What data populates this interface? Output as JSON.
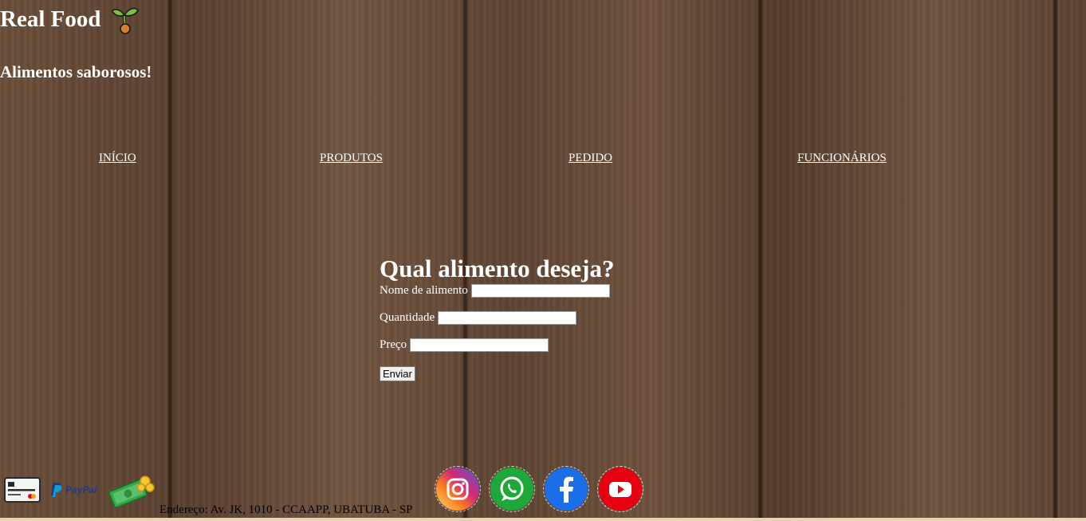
{
  "header": {
    "title": "Real Food",
    "title_icon": "sprout-icon",
    "tagline": "Alimentos saborosos!"
  },
  "nav": {
    "items": [
      {
        "label": "INÍCIO"
      },
      {
        "label": "PRODUTOS"
      },
      {
        "label": "PEDIDO"
      },
      {
        "label": "FUNCIONÁRIOS"
      }
    ]
  },
  "form": {
    "title": "Qual alimento deseja?",
    "fields": [
      {
        "label": "Nome de alimento",
        "value": ""
      },
      {
        "label": "Quantidade",
        "value": ""
      },
      {
        "label": "Preço",
        "value": ""
      }
    ],
    "submit_label": "Enviar"
  },
  "footer": {
    "payment_icons": [
      "credit-card-icon",
      "paypal-icon",
      "cash-icon"
    ],
    "paypal_text": "PayPal",
    "social_icons": [
      "instagram-icon",
      "whatsapp-icon",
      "facebook-icon",
      "youtube-icon"
    ],
    "address": "Endereço: Av. JK, 1010 - CCAAPP, UBATUBA - SP"
  },
  "colors": {
    "instagram": "#c13584",
    "whatsapp": "#25d366",
    "facebook": "#1877f2",
    "youtube": "#e60012"
  }
}
